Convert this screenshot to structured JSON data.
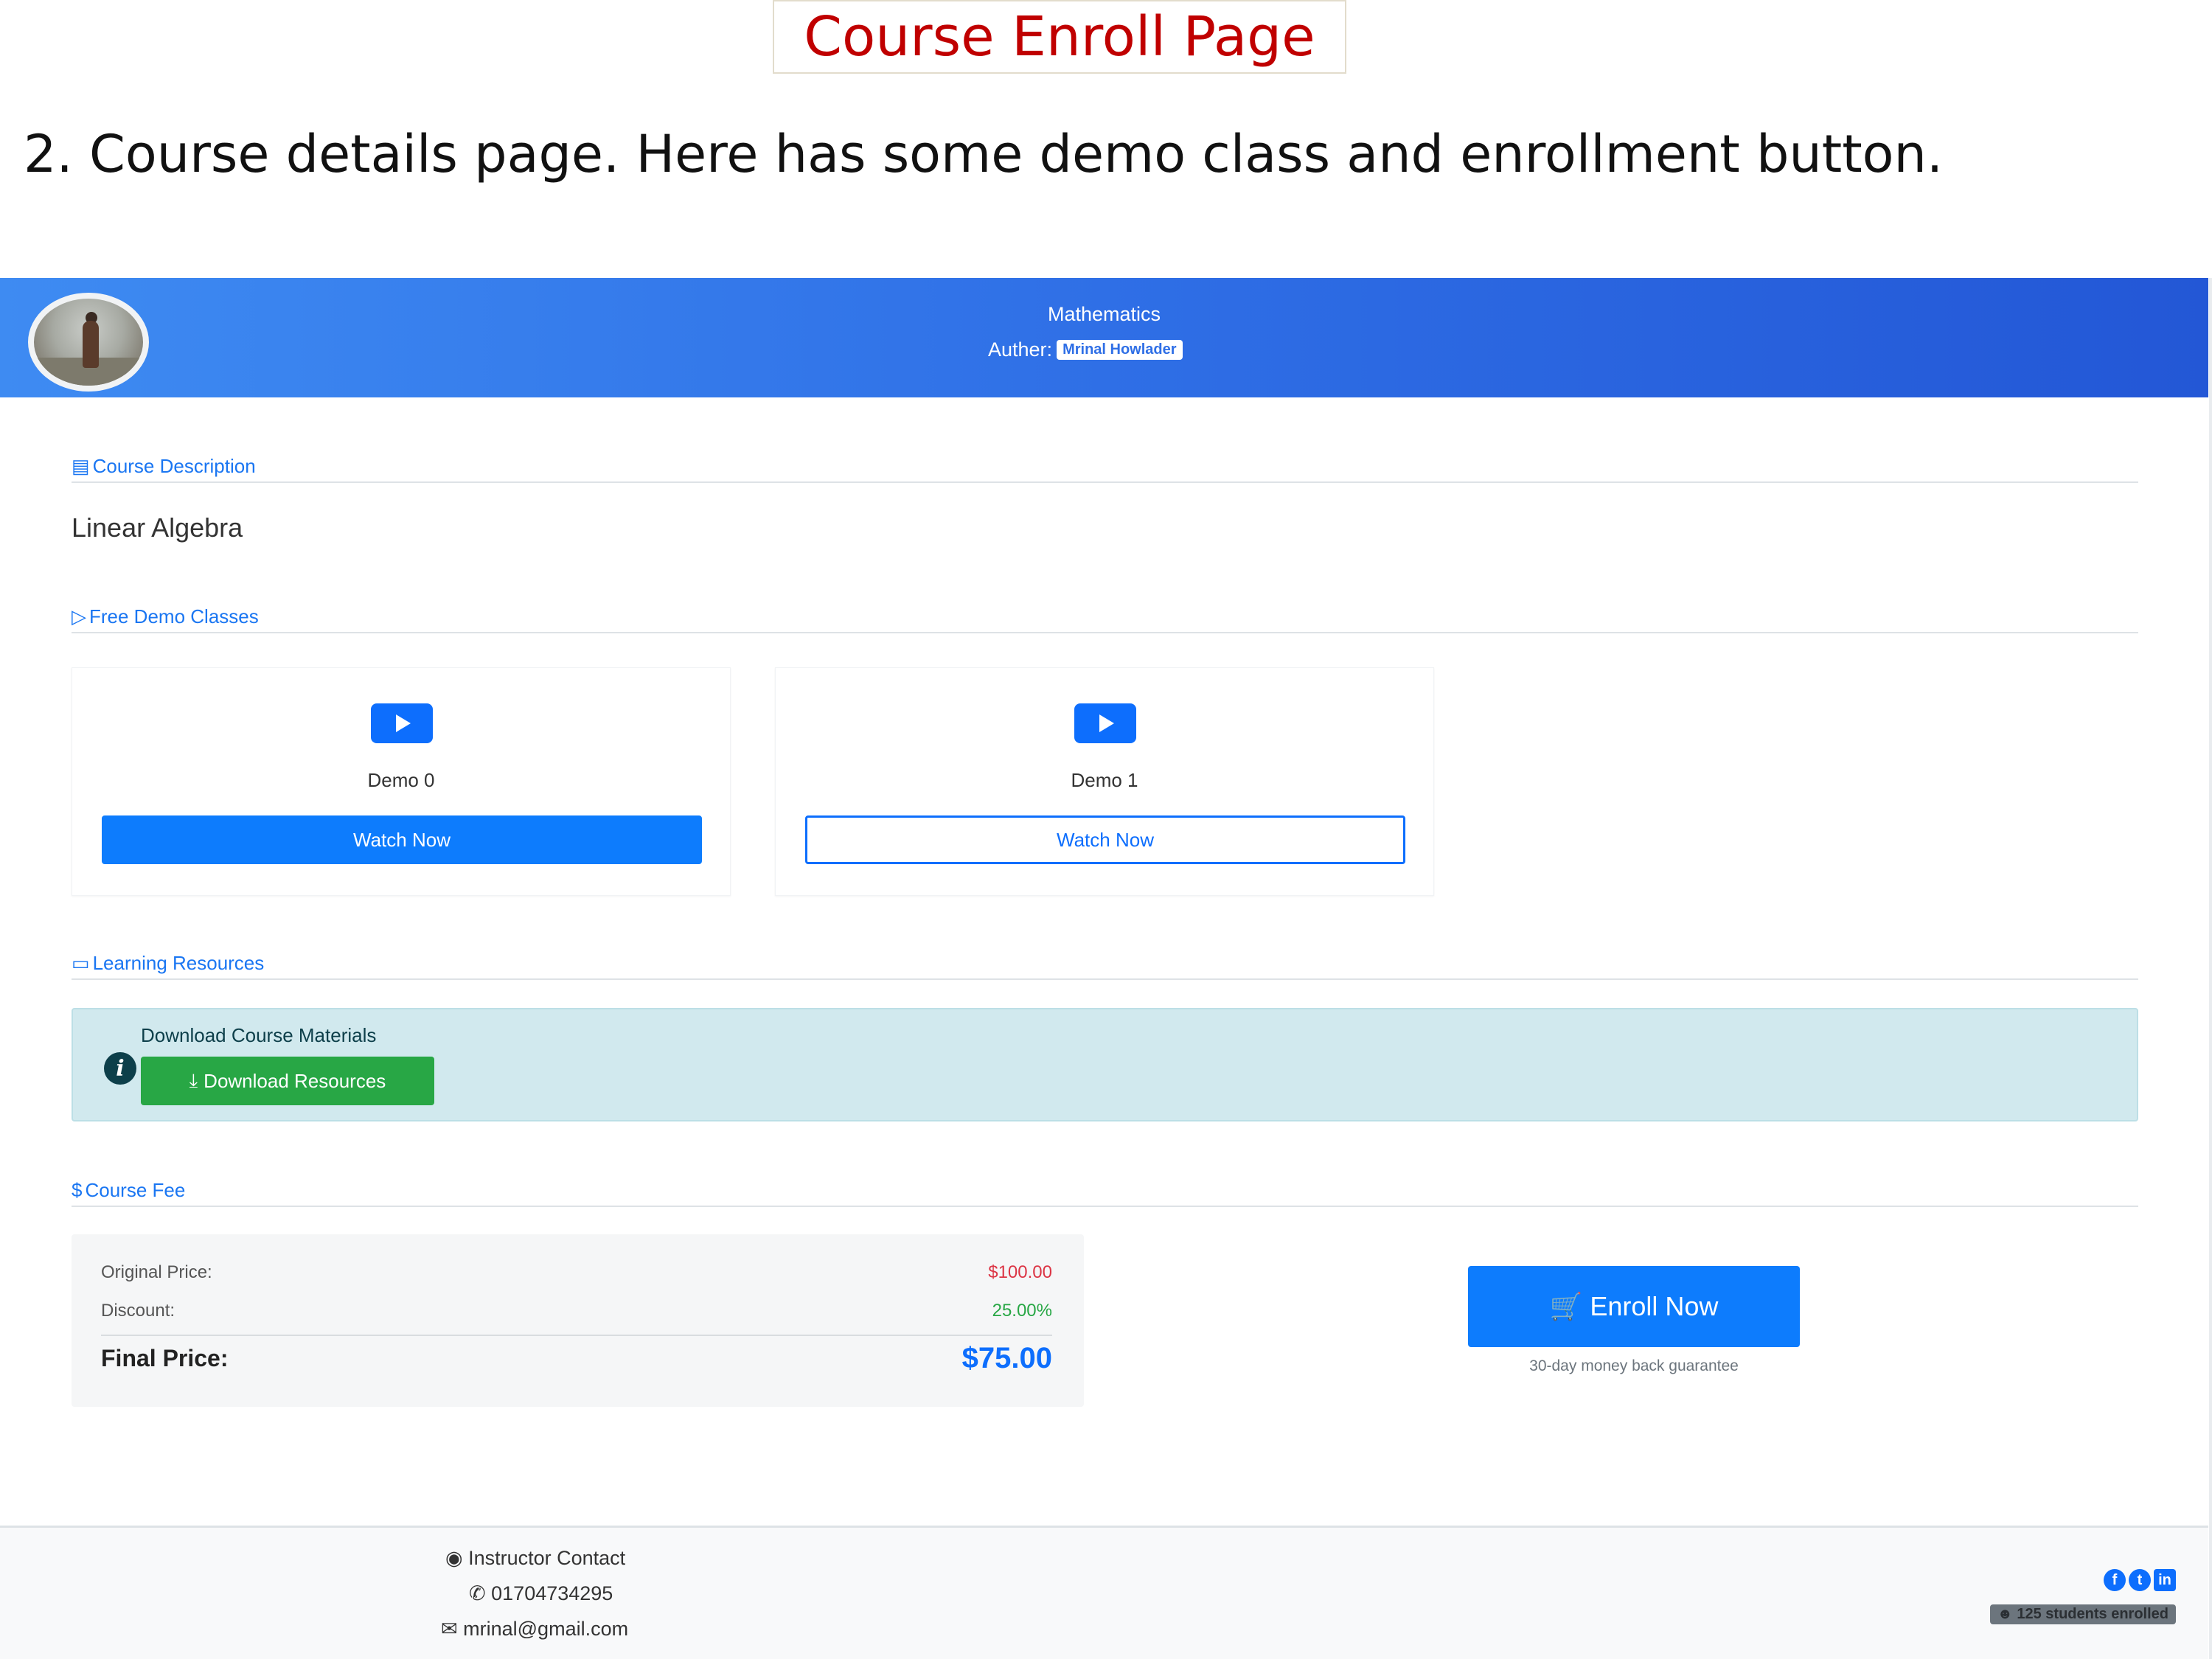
{
  "slide": {
    "title": "Course Enroll Page",
    "caption": "2. Course details page. Here has some demo class and enrollment button."
  },
  "header": {
    "subject": "Mathematics",
    "author_label": "Auther:",
    "author_name": "Mrinal Howlader"
  },
  "sections": {
    "description": {
      "heading": "Course Description",
      "text": "Linear Algebra"
    },
    "demos": {
      "heading": "Free Demo Classes",
      "items": [
        {
          "title": "Demo 0",
          "button": "Watch Now"
        },
        {
          "title": "Demo 1",
          "button": "Watch Now"
        }
      ]
    },
    "resources": {
      "heading": "Learning Resources",
      "title": "Download Course Materials",
      "button": "Download Resources"
    },
    "fee": {
      "heading": "Course Fee",
      "original_label": "Original Price:",
      "original_value": "$100.00",
      "discount_label": "Discount:",
      "discount_value": "25.00%",
      "final_label": "Final Price:",
      "final_value": "$75.00"
    }
  },
  "enroll": {
    "button": "Enroll Now",
    "note": "30-day money back guarantee"
  },
  "footer": {
    "contact_heading": "Instructor Contact",
    "phone": "01704734295",
    "email": "mrinal@gmail.com",
    "enrolled": "125 students enrolled"
  },
  "colors": {
    "primary": "#0d6efd",
    "success": "#28a745",
    "danger": "#dc3545",
    "slide_title": "#c00000"
  }
}
